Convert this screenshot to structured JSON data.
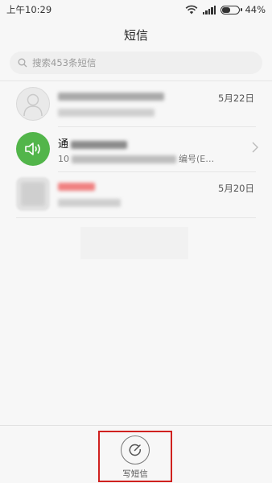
{
  "status_bar": {
    "time": "上午10:29",
    "battery": "44%",
    "battery_level": 0.44
  },
  "header": {
    "title": "短信"
  },
  "search": {
    "placeholder": "搜索453条短信"
  },
  "conversations": [
    {
      "name": "",
      "snippet": "",
      "date": "5月22日",
      "avatar": "person-icon",
      "name_blurred": true,
      "snippet_blurred": true
    },
    {
      "name": "通",
      "snippet_prefix": "10",
      "snippet_suffix": "编号(E…",
      "date": "",
      "avatar": "speaker-icon",
      "has_chevron": true
    },
    {
      "name": "",
      "snippet": "",
      "date": "5月20日",
      "avatar": "blurred-image",
      "name_color": "#f08080"
    }
  ],
  "compose": {
    "label": "写短信"
  },
  "colors": {
    "accent_green": "#52b54a",
    "highlight_red": "#d0211f"
  }
}
